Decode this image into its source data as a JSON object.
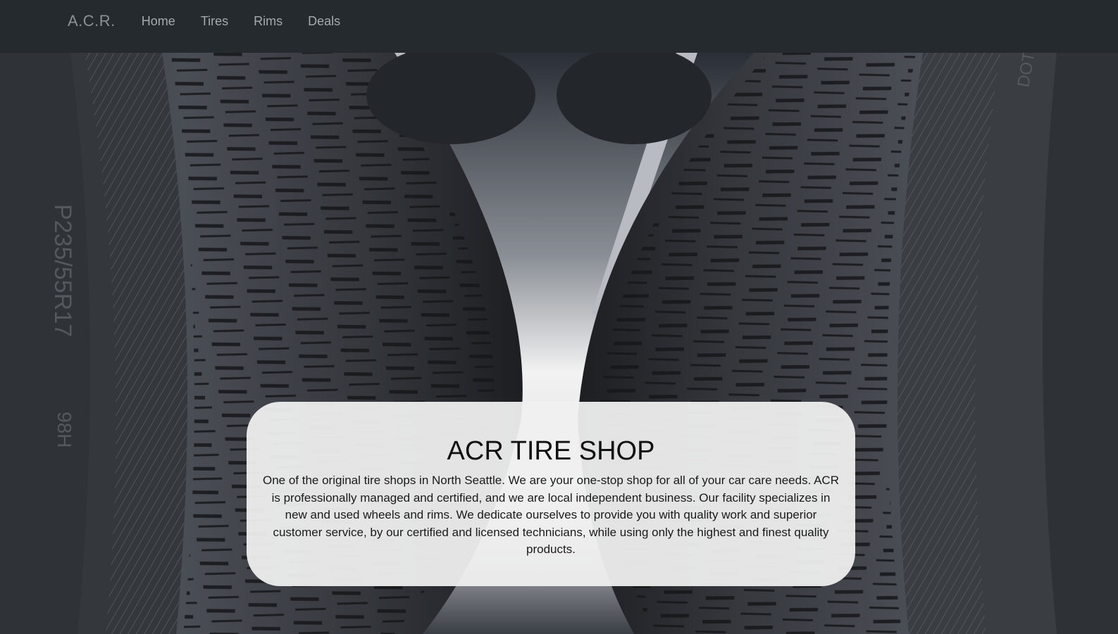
{
  "navbar": {
    "brand": "A.C.R.",
    "links": [
      "Home",
      "Tires",
      "Rims",
      "Deals"
    ]
  },
  "hero": {
    "image": "tire-rack-photo",
    "sidewall_text_left": "P235/55R17",
    "sidewall_text_left_2": "98H",
    "sidewall_text_right": "DOT"
  },
  "card": {
    "title": "ACR TIRE SHOP",
    "description": "One of the original tire shops in North Seattle. We are your one-stop shop for all of your car care needs. ACR is professionally managed and certified, and we are local independent business. Our facility specializes in new and used wheels and rims. We dedicate ourselves to provide you with quality work and superior customer service, by our certified and licensed technicians, while using only the highest and finest quality products."
  },
  "colors": {
    "navbar_bg": "#252a2e",
    "card_bg": "#f0f0f0"
  }
}
